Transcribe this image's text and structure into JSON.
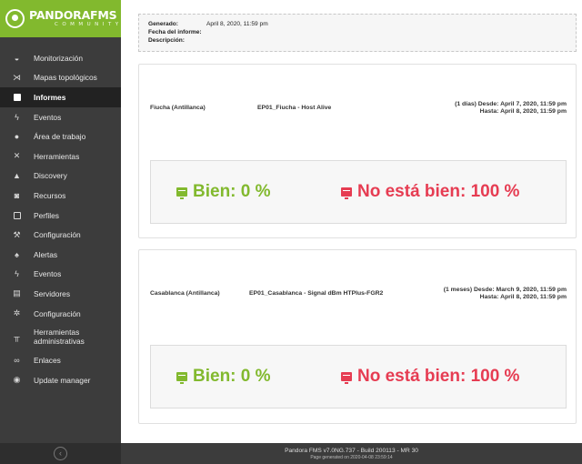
{
  "brand": {
    "name": "PANDORAFMS",
    "edition": "COMMUNITY",
    "accent_color": "#82b92e"
  },
  "sidebar": {
    "items": [
      {
        "label": "Monitorización",
        "icon": "monitor-icon"
      },
      {
        "label": "Mapas topológicos",
        "icon": "topology-map-icon"
      },
      {
        "label": "Informes",
        "icon": "reports-icon",
        "active": true
      },
      {
        "label": "Eventos",
        "icon": "lightning-icon"
      },
      {
        "label": "Área de trabajo",
        "icon": "user-icon"
      },
      {
        "label": "Herramientas",
        "icon": "tools-icon"
      },
      {
        "label": "Discovery",
        "icon": "discovery-icon"
      },
      {
        "label": "Recursos",
        "icon": "resources-icon"
      },
      {
        "label": "Perfiles",
        "icon": "profile-icon"
      },
      {
        "label": "Configuración",
        "icon": "wrench-icon"
      },
      {
        "label": "Alertas",
        "icon": "bell-icon"
      },
      {
        "label": "Eventos",
        "icon": "lightning-gear-icon"
      },
      {
        "label": "Servidores",
        "icon": "server-icon"
      },
      {
        "label": "Configuración",
        "icon": "gear-icon"
      },
      {
        "label": "Herramientas administrativas",
        "icon": "admin-tools-icon"
      },
      {
        "label": "Enlaces",
        "icon": "link-icon"
      },
      {
        "label": "Update manager",
        "icon": "update-icon"
      }
    ]
  },
  "report_info": {
    "generated_label": "Generado:",
    "generated_value": "April 8, 2020, 11:59 pm",
    "report_date_label": "Fecha del informe:",
    "report_date_value": "",
    "description_label": "Descripción:",
    "description_value": ""
  },
  "reports": [
    {
      "agent": "Fiucha (Antillanca)",
      "module": "EP01_Fiucha - Host Alive",
      "period_from": "(1 días) Desde: April 7, 2020, 11:59 pm",
      "period_to": "Hasta: April 8, 2020, 11:59 pm",
      "ok_label": "Bien: 0 %",
      "bad_label": "No está bien: 100 %",
      "ok_percent": 0,
      "bad_percent": 100
    },
    {
      "agent": "Casablanca (Antillanca)",
      "module": "EP01_Casablanca - Signal dBm HTPlus-FGR2",
      "period_from": "(1 meses) Desde: March 9, 2020, 11:59 pm",
      "period_to": "Hasta: April 8, 2020, 11:59 pm",
      "ok_label": "Bien: 0 %",
      "bad_label": "No está bien: 100 %",
      "ok_percent": 0,
      "bad_percent": 100
    }
  ],
  "colors": {
    "ok": "#82b92e",
    "bad": "#e63c52",
    "sidebar_bg": "#3c3c3c"
  },
  "footer": {
    "version": "Pandora FMS v7.0NG.737 - Build 200113 - MR 30",
    "generated": "Page generated on 2020-04-08 23:59:14"
  }
}
